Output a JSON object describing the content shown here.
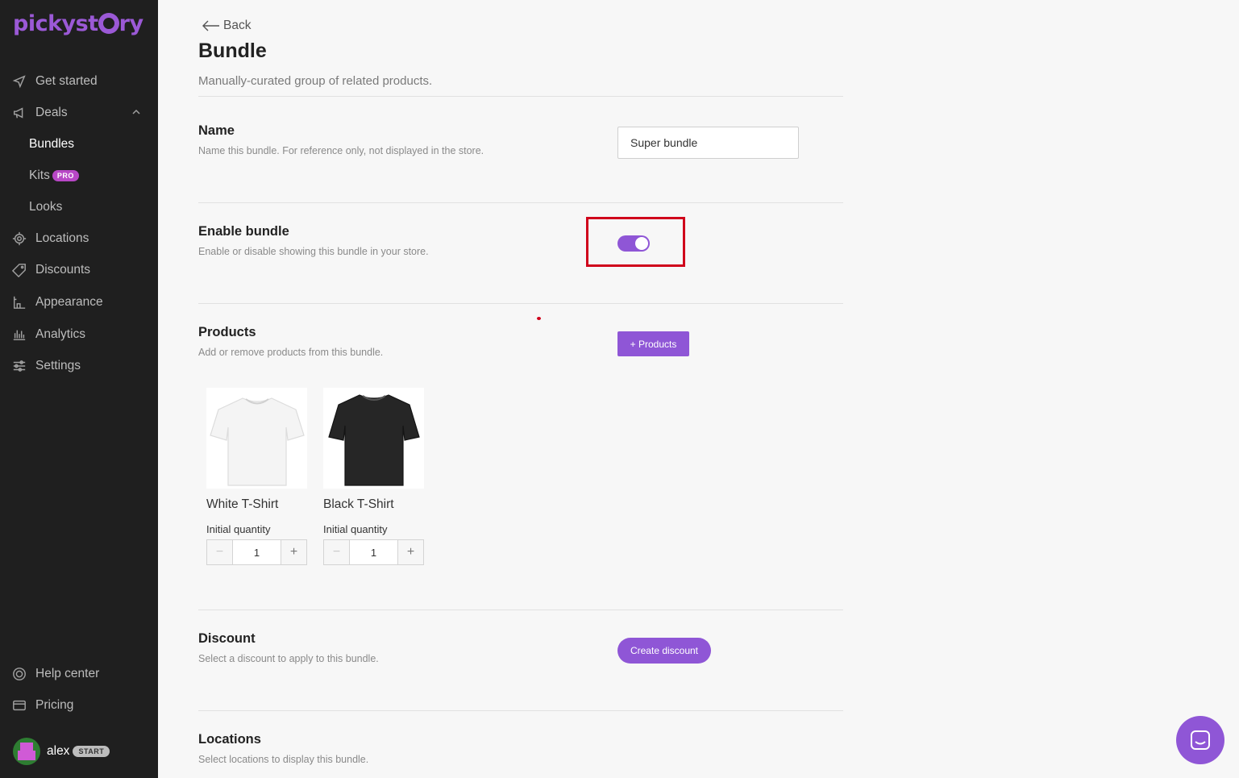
{
  "brand": {
    "logo_text_1": "pickyst",
    "logo_text_2": "ry",
    "accent": "#8f56d6"
  },
  "sidebar": {
    "items": [
      {
        "label": "Get started",
        "icon": "send-icon"
      },
      {
        "label": "Deals",
        "icon": "megaphone-icon"
      },
      {
        "label": "Bundles"
      },
      {
        "label": "Kits",
        "badge": "PRO"
      },
      {
        "label": "Looks"
      },
      {
        "label": "Locations",
        "icon": "location-icon"
      },
      {
        "label": "Discounts",
        "icon": "tag-icon"
      },
      {
        "label": "Appearance",
        "icon": "appearance-icon"
      },
      {
        "label": "Analytics",
        "icon": "analytics-icon"
      },
      {
        "label": "Settings",
        "icon": "sliders-icon"
      }
    ],
    "bottom": [
      {
        "label": "Help center",
        "icon": "lifebuoy-icon"
      },
      {
        "label": "Pricing",
        "icon": "credit-card-icon"
      }
    ],
    "user": {
      "name": "alex",
      "plan": "START"
    }
  },
  "header": {
    "back_label": "Back",
    "title": "Bundle",
    "subtitle": "Manually-curated group of related products."
  },
  "sections": {
    "name": {
      "title": "Name",
      "desc": "Name this bundle. For reference only, not displayed in the store.",
      "value": "Super bundle"
    },
    "enable": {
      "title": "Enable bundle",
      "desc": "Enable or disable showing this bundle in your store.",
      "enabled": true
    },
    "products": {
      "title": "Products",
      "desc": "Add or remove products from this bundle.",
      "button": "+ Products",
      "items": [
        {
          "name": "White T-Shirt",
          "qty_label": "Initial quantity",
          "qty": "1",
          "minus": "−",
          "plus": "+"
        },
        {
          "name": "Black T-Shirt",
          "qty_label": "Initial quantity",
          "qty": "1",
          "minus": "−",
          "plus": "+"
        }
      ]
    },
    "discount": {
      "title": "Discount",
      "desc": "Select a discount to apply to this bundle.",
      "button": "Create discount"
    },
    "locations": {
      "title": "Locations",
      "desc": "Select locations to display this bundle."
    }
  }
}
